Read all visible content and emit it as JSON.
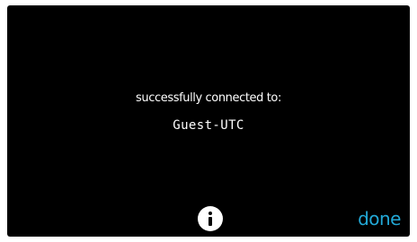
{
  "screen": {
    "message": "successfully connected to:",
    "network_name": "Guest-UTC"
  },
  "controls": {
    "info_icon": "info-circle-icon",
    "done_label": "done"
  },
  "colors": {
    "background": "#000000",
    "text": "#ffffff",
    "accent": "#22a8d6"
  }
}
